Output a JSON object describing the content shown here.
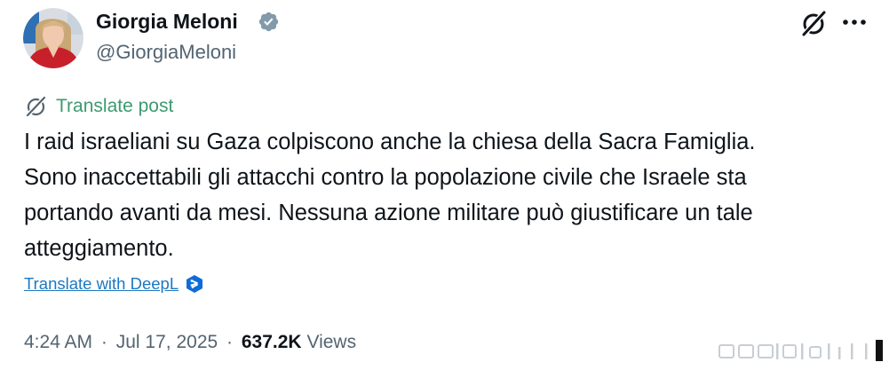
{
  "author": {
    "name": "Giorgia Meloni",
    "handle": "@GiorgiaMeloni",
    "verified": true,
    "verified_color": "#829aab"
  },
  "icons": {
    "verified": "verified-badge-icon",
    "grok": "grok-icon",
    "more": "more-dots-icon",
    "translate": "globe-icon",
    "deepl": "deepl-icon"
  },
  "translate_post_label": "Translate post",
  "tweet_lines": [
    "I raid israeliani su Gaza colpiscono anche la chiesa della Sacra Famiglia.",
    "Sono inaccettabili gli attacchi contro la popolazione civile che Israele sta",
    "portando avanti da mesi. Nessuna azione militare può giustificare un tale",
    "atteggiamento."
  ],
  "deepl_label": "Translate with DeepL",
  "meta": {
    "time": "4:24 AM",
    "separator": "·",
    "date": "Jul 17, 2025",
    "views_count": "637.2K",
    "views_label": "Views"
  },
  "colors": {
    "translate_green": "#3c9a70",
    "link_blue": "#1d78c1",
    "secondary_text": "#536471",
    "primary_text": "#0f1419"
  }
}
